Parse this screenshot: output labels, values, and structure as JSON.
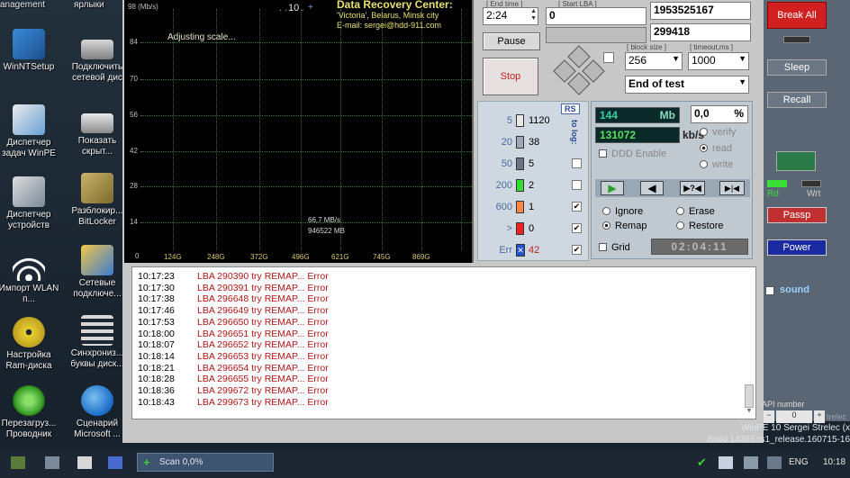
{
  "desktop": {
    "top_labels": [
      "anagement",
      "ярлыки"
    ],
    "icons": [
      {
        "label": "WinNTSetup"
      },
      {
        "label": "Подключить сетевой дис"
      },
      {
        "label": "Диспетчер задач WinPE"
      },
      {
        "label": "Показать скрыт..."
      },
      {
        "label": "Диспетчер устройств"
      },
      {
        "label": "Разблокир... BitLocker"
      },
      {
        "label": "Импорт WLAN п..."
      },
      {
        "label": "Сетевые подключе..."
      },
      {
        "label": "Настройка Ram-диска"
      },
      {
        "label": "Синхрониз... буквы диск..."
      },
      {
        "label": "Перезагруз... Проводник"
      },
      {
        "label": "Сценарий Microsoft ..."
      }
    ]
  },
  "graph": {
    "unit_label": "98 (Mb/s)",
    "top_right": "10",
    "status": "Adjusting scale...",
    "y_ticks": [
      "84",
      "70",
      "56",
      "42",
      "28",
      "14",
      "0"
    ],
    "x_ticks": [
      "124G",
      "248G",
      "372G",
      "496G",
      "621G",
      "745G",
      "869G"
    ],
    "speed_readout": "66,7 MB/s",
    "pos_readout": "946522 MB",
    "recovery_title": "Data Recovery Center:",
    "recovery_city": "'Victoria', Belarus, Minsk city",
    "recovery_email": "E-mail: sergei@hdd-911.com"
  },
  "controls": {
    "end_time_label": "[ End time ]",
    "end_time_value": "2:24",
    "start_lba_label": "[ Start LBA ]",
    "start_lba_value": "0",
    "end_lba_value": "1953525167",
    "current_lba_value": "299418",
    "pause_label": "Pause",
    "stop_label": "Stop",
    "block_size_label": "[ block size ]",
    "block_size_value": "256",
    "timeout_label": "[ timeout,ms ]",
    "timeout_value": "1000",
    "end_action_value": "End of test"
  },
  "blocks": {
    "rs_label": "RS",
    "to_log_label": "to log:",
    "rows": [
      {
        "label": "5",
        "count": "1120",
        "color": "#e8e8e8",
        "checked": ""
      },
      {
        "label": "20",
        "count": "38",
        "color": "#a0a8b4",
        "checked": ""
      },
      {
        "label": "50",
        "count": "5",
        "color": "#6c7480",
        "checked": ""
      },
      {
        "label": "200",
        "count": "2",
        "color": "#33dd33",
        "checked": ""
      },
      {
        "label": "600",
        "count": "1",
        "color": "#ff8844",
        "checked": "✔"
      },
      {
        "label": ">",
        "count": "0",
        "color": "#ee2222",
        "checked": "✔"
      },
      {
        "label": "Err",
        "count": "42",
        "color": "#2255cc",
        "checked": "✔"
      }
    ],
    "err_mark": "✕"
  },
  "stats": {
    "mb_value": "144",
    "mb_unit": "Mb",
    "percent_value": "0,0",
    "percent_unit": "%",
    "speed_value": "131072",
    "speed_unit": "kb/s",
    "ddd_label": "DDD Enable",
    "verify_label": "verify",
    "read_label": "read",
    "write_label": "write",
    "ignore_label": "Ignore",
    "erase_label": "Erase",
    "remap_label": "Remap",
    "restore_label": "Restore",
    "grid_label": "Grid",
    "grid_time": "02:04:11"
  },
  "right_panel": {
    "break_all": "Break All",
    "sleep": "Sleep",
    "recall": "Recall",
    "rd_label": "Rd",
    "wrt_label": "Wrt",
    "passp": "Passp",
    "power": "Power",
    "sound": "sound",
    "api_label": "API number",
    "api_value": "0",
    "api_minus": "−",
    "api_plus": "+"
  },
  "log": [
    {
      "time": "10:17:23",
      "msg": "LBA 290390 try REMAP... Error"
    },
    {
      "time": "10:17:30",
      "msg": "LBA 290391 try REMAP... Error"
    },
    {
      "time": "10:17:38",
      "msg": "LBA 296648 try REMAP... Error"
    },
    {
      "time": "10:17:46",
      "msg": "LBA 296649 try REMAP... Error"
    },
    {
      "time": "10:17:53",
      "msg": "LBA 296650 try REMAP... Error"
    },
    {
      "time": "10:18:00",
      "msg": "LBA 296651 try REMAP... Error"
    },
    {
      "time": "10:18:07",
      "msg": "LBA 296652 try REMAP... Error"
    },
    {
      "time": "10:18:14",
      "msg": "LBA 296653 try REMAP... Error"
    },
    {
      "time": "10:18:21",
      "msg": "LBA 296654 try REMAP... Error"
    },
    {
      "time": "10:18:28",
      "msg": "LBA 296655 try REMAP... Error"
    },
    {
      "time": "10:18:36",
      "msg": "LBA 299672 try REMAP... Error"
    },
    {
      "time": "10:18:43",
      "msg": "LBA 299673 try REMAP... Error"
    }
  ],
  "system_info": {
    "line1": "WinPE 10 Sergei Strelec (x",
    "line2": "Build 14393.rs1_release.160715-16",
    "edge_text": "trelec"
  },
  "taskbar": {
    "scan_label": "Scan 0,0%",
    "lang": "ENG",
    "clock": "10:18"
  }
}
